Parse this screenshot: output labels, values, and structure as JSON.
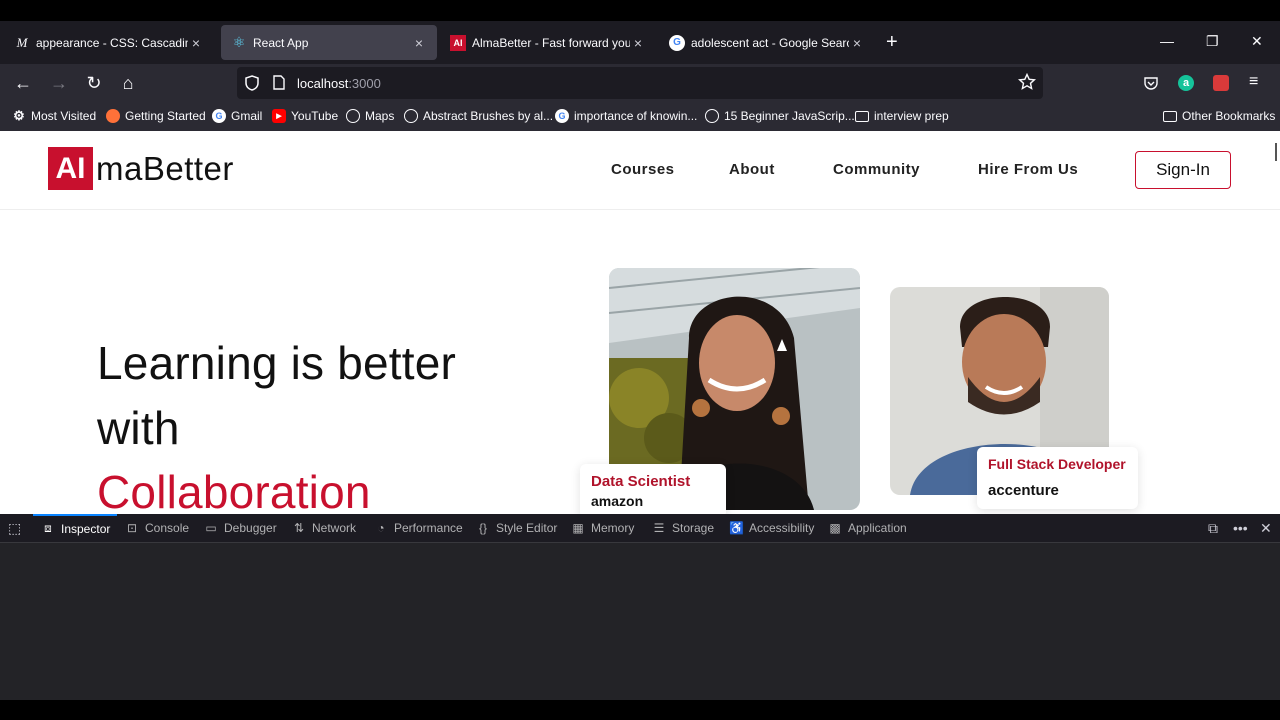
{
  "tabs": [
    {
      "icon": "M",
      "title": "appearance - CSS: Cascading Style",
      "active": false
    },
    {
      "icon": "⚛",
      "title": "React App",
      "active": true
    },
    {
      "icon": "AI",
      "title": "AlmaBetter - Fast forward your ca",
      "active": false
    },
    {
      "icon": "G",
      "title": "adolescent act - Google Search",
      "active": false
    }
  ],
  "tab_close": "×",
  "new_tab": "+",
  "window": {
    "minimize": "—",
    "restore": "❐",
    "close": "✕"
  },
  "nav": {
    "back": "←",
    "forward": "→",
    "reload": "↻",
    "home": "⌂"
  },
  "url": {
    "host": "localhost",
    "port": ":3000"
  },
  "bookmarks": [
    {
      "label": "Most Visited",
      "icon": "gear"
    },
    {
      "label": "Getting Started",
      "icon": "firefox"
    },
    {
      "label": "Gmail",
      "icon": "google"
    },
    {
      "label": "YouTube",
      "icon": "youtube"
    },
    {
      "label": "Maps",
      "icon": "globe"
    },
    {
      "label": "Abstract Brushes by al...",
      "icon": "globe"
    },
    {
      "label": "importance of knowin...",
      "icon": "google"
    },
    {
      "label": "15 Beginner JavaScrip...",
      "icon": "globe"
    },
    {
      "label": "interview prep",
      "icon": "folder"
    }
  ],
  "other_bookmarks": "Other Bookmarks",
  "site": {
    "logo_mark": "AI",
    "logo_rest": "maBetter",
    "nav": [
      "Courses",
      "About",
      "Community",
      "Hire From Us"
    ],
    "signin": "Sign-In",
    "hero": {
      "line1": "Learning is better",
      "line2": "with",
      "line3": "Collaboration"
    },
    "card1": {
      "role": "Data Scientist",
      "company": "amazon"
    },
    "card2": {
      "role": "Full Stack Developer",
      "company": "accenture"
    }
  },
  "devtools": {
    "tabs": [
      "Inspector",
      "Console",
      "Debugger",
      "Network",
      "Performance",
      "Style Editor",
      "Memory",
      "Storage",
      "Accessibility",
      "Application"
    ],
    "active": "Inspector"
  },
  "colors": {
    "brand": "#c8102e",
    "accent": "#0a84ff"
  }
}
